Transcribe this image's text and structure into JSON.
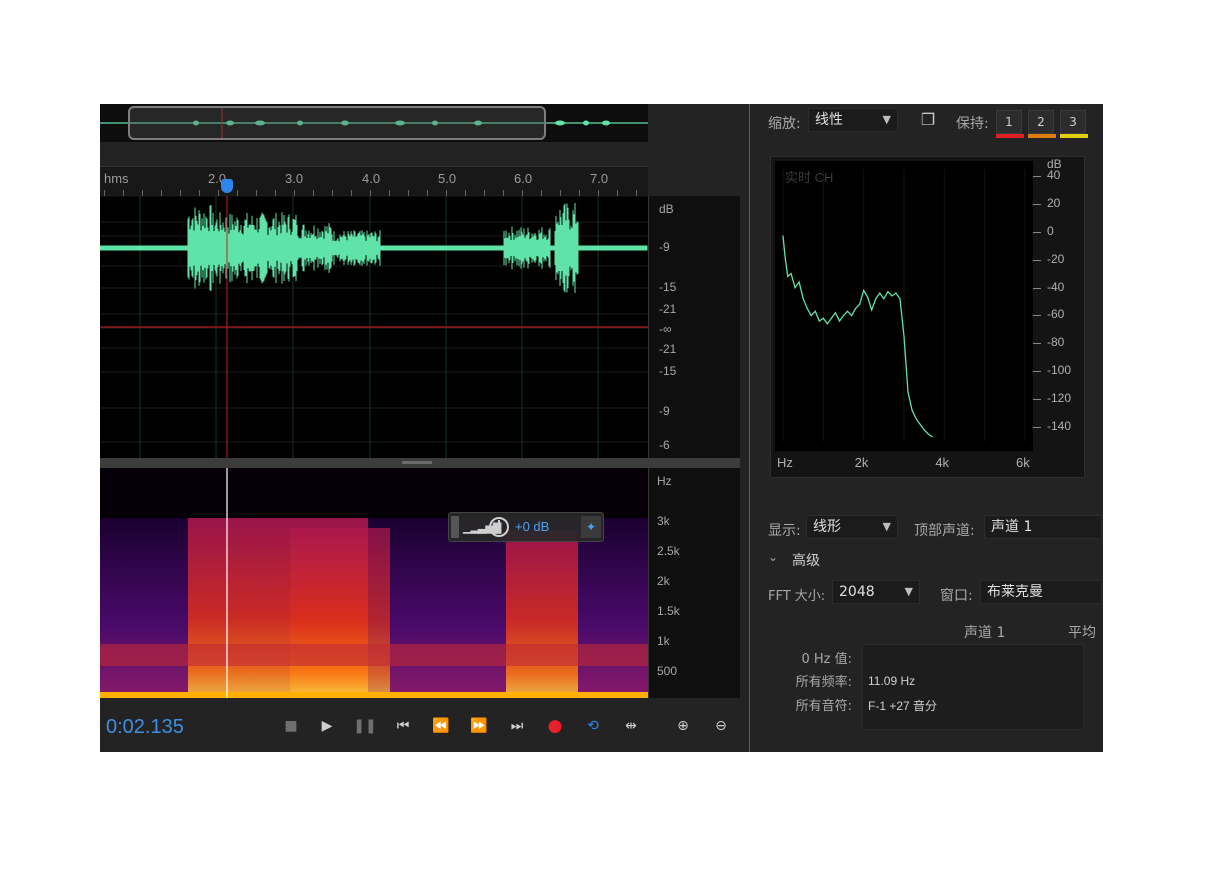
{
  "ruler": {
    "unit": "hms",
    "ticks": [
      "2.0",
      "3.0",
      "4.0",
      "5.0",
      "6.0",
      "7.0"
    ]
  },
  "waveform": {
    "db_labels": [
      "dB",
      "-9",
      "-15",
      "-21",
      "-∞",
      "-21",
      "-15",
      "-9",
      "-6"
    ],
    "color": "#5fe3a8"
  },
  "spectral": {
    "hz_labels": [
      "Hz",
      "3k",
      "2.5k",
      "2k",
      "1.5k",
      "1k",
      "500"
    ]
  },
  "hud": {
    "gain": "+0 dB"
  },
  "transport": {
    "timecode": "0:02.135"
  },
  "analysis": {
    "zoom_label": "缩放:",
    "zoom_value": "线性",
    "hold_label": "保持:",
    "hold_buttons": [
      "1",
      "2",
      "3"
    ],
    "hold_colors": [
      "#e02020",
      "#e07a10",
      "#e0d010"
    ],
    "graph_title": "实时 CH",
    "y_labels": [
      "dB",
      "40",
      "20",
      "0",
      "-20",
      "-40",
      "-60",
      "-80",
      "-100",
      "-120",
      "-140"
    ],
    "x_labels": [
      "Hz",
      "2k",
      "4k",
      "6k"
    ],
    "display_label": "显示:",
    "display_value": "线形",
    "top_channel_label": "顶部声道:",
    "top_channel_value": "声道 1",
    "advanced_label": "高级",
    "fft_label": "FFT 大小:",
    "fft_value": "2048",
    "window_label": "窗口:",
    "window_value": "布莱克曼",
    "col_channel": "声道 1",
    "col_average": "平均",
    "row_0hz": "0 Hz 值:",
    "row_freq": "所有频率:",
    "row_freq_value": "11.09 Hz",
    "row_note": "所有音符:",
    "row_note_value": "F-1 +27 音分"
  },
  "chart_data": {
    "type": "line",
    "x_unit": "Hz",
    "y_unit": "dB",
    "ylim": [
      -150,
      45
    ],
    "xlim": [
      0,
      6000
    ],
    "x": [
      0,
      60,
      120,
      200,
      300,
      400,
      500,
      600,
      700,
      800,
      900,
      1000,
      1100,
      1200,
      1300,
      1400,
      1500,
      1600,
      1700,
      1800,
      1900,
      2000,
      2100,
      2200,
      2300,
      2400,
      2500,
      2600,
      2700,
      2800,
      2900,
      3000,
      3100,
      3200,
      3300,
      3400,
      3500,
      3600,
      3700
    ],
    "y": [
      -3,
      -20,
      -32,
      -30,
      -40,
      -36,
      -48,
      -55,
      -60,
      -57,
      -64,
      -62,
      -66,
      -62,
      -58,
      -64,
      -60,
      -57,
      -60,
      -55,
      -52,
      -42,
      -47,
      -56,
      -48,
      -44,
      -48,
      -43,
      -46,
      -44,
      -48,
      -75,
      -115,
      -128,
      -134,
      -138,
      -142,
      -145,
      -147
    ]
  }
}
